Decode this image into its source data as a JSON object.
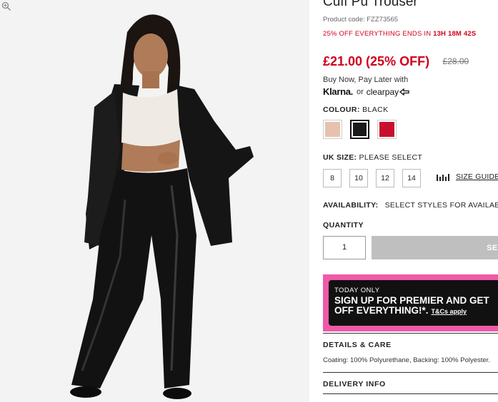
{
  "product": {
    "title": "Cuff Pu Trouser",
    "product_code": "Product code: FZZ73565",
    "promo_text": "25% OFF EVERYTHING ENDS IN",
    "promo_timer": "13H 18M 42S",
    "price_now": "£21.00 (25% OFF)",
    "price_was": "£28.00"
  },
  "payment": {
    "bnpl_label": "Buy Now, Pay Later with",
    "klarna": "Klarna.",
    "or": "or",
    "clearpay": "clearpay"
  },
  "colour": {
    "label": "COLOUR:",
    "value": "BLACK",
    "swatches": [
      {
        "name": "nude",
        "color": "#e6c2ae"
      },
      {
        "name": "black",
        "color": "#1a1a1a"
      },
      {
        "name": "red",
        "color": "#c8102e"
      }
    ]
  },
  "size": {
    "label": "UK SIZE:",
    "value": "PLEASE SELECT",
    "options": [
      "8",
      "10",
      "12",
      "14"
    ],
    "guide_label": "SIZE GUIDE"
  },
  "availability": {
    "label": "AVAILABILITY:",
    "value": "SELECT STYLES FOR AVAILABILITY"
  },
  "quantity": {
    "label": "QUANTITY",
    "value": "1"
  },
  "add_button": {
    "label": "SEL"
  },
  "premier": {
    "today_only": "TODAY ONLY",
    "line1": "SIGN UP FOR PREMIER AND GET",
    "line2": "OFF EVERYTHING!*.",
    "tcs": "T&Cs apply"
  },
  "sections": {
    "details_heading": "DETAILS & CARE",
    "details_text": "Coating: 100% Polyurethane, Backing: 100% Polyester.",
    "delivery_heading": "DELIVERY INFO"
  },
  "colors": {
    "sale_red": "#d0021b",
    "premier_pink": "#ee5aa7",
    "add_button_grey": "#bfbfbf"
  }
}
